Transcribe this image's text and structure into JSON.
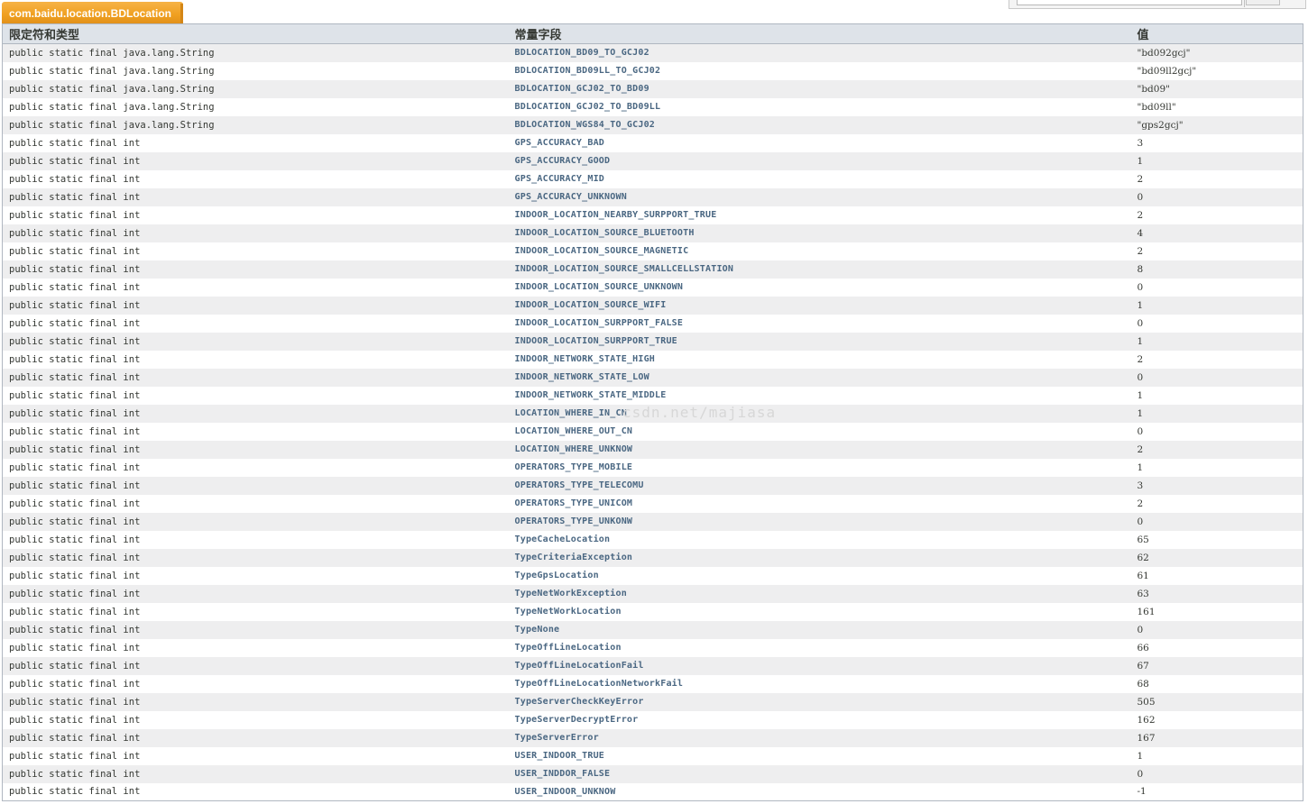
{
  "caption": "com.baidu.location.BDLocation",
  "watermark": "csdn.net/majiasa",
  "headers": [
    "限定符和类型",
    "常量字段",
    "值"
  ],
  "rows": [
    {
      "modifier": "public static final java.lang.String",
      "name": "BDLOCATION_BD09_TO_GCJ02",
      "value": "\"bd092gcj\""
    },
    {
      "modifier": "public static final java.lang.String",
      "name": "BDLOCATION_BD09LL_TO_GCJ02",
      "value": "\"bd09ll2gcj\""
    },
    {
      "modifier": "public static final java.lang.String",
      "name": "BDLOCATION_GCJ02_TO_BD09",
      "value": "\"bd09\""
    },
    {
      "modifier": "public static final java.lang.String",
      "name": "BDLOCATION_GCJ02_TO_BD09LL",
      "value": "\"bd09ll\""
    },
    {
      "modifier": "public static final java.lang.String",
      "name": "BDLOCATION_WGS84_TO_GCJ02",
      "value": "\"gps2gcj\""
    },
    {
      "modifier": "public static final int",
      "name": "GPS_ACCURACY_BAD",
      "value": "3"
    },
    {
      "modifier": "public static final int",
      "name": "GPS_ACCURACY_GOOD",
      "value": "1"
    },
    {
      "modifier": "public static final int",
      "name": "GPS_ACCURACY_MID",
      "value": "2"
    },
    {
      "modifier": "public static final int",
      "name": "GPS_ACCURACY_UNKNOWN",
      "value": "0"
    },
    {
      "modifier": "public static final int",
      "name": "INDOOR_LOCATION_NEARBY_SURPPORT_TRUE",
      "value": "2"
    },
    {
      "modifier": "public static final int",
      "name": "INDOOR_LOCATION_SOURCE_BLUETOOTH",
      "value": "4"
    },
    {
      "modifier": "public static final int",
      "name": "INDOOR_LOCATION_SOURCE_MAGNETIC",
      "value": "2"
    },
    {
      "modifier": "public static final int",
      "name": "INDOOR_LOCATION_SOURCE_SMALLCELLSTATION",
      "value": "8"
    },
    {
      "modifier": "public static final int",
      "name": "INDOOR_LOCATION_SOURCE_UNKNOWN",
      "value": "0"
    },
    {
      "modifier": "public static final int",
      "name": "INDOOR_LOCATION_SOURCE_WIFI",
      "value": "1"
    },
    {
      "modifier": "public static final int",
      "name": "INDOOR_LOCATION_SURPPORT_FALSE",
      "value": "0"
    },
    {
      "modifier": "public static final int",
      "name": "INDOOR_LOCATION_SURPPORT_TRUE",
      "value": "1"
    },
    {
      "modifier": "public static final int",
      "name": "INDOOR_NETWORK_STATE_HIGH",
      "value": "2"
    },
    {
      "modifier": "public static final int",
      "name": "INDOOR_NETWORK_STATE_LOW",
      "value": "0"
    },
    {
      "modifier": "public static final int",
      "name": "INDOOR_NETWORK_STATE_MIDDLE",
      "value": "1"
    },
    {
      "modifier": "public static final int",
      "name": "LOCATION_WHERE_IN_CN",
      "value": "1"
    },
    {
      "modifier": "public static final int",
      "name": "LOCATION_WHERE_OUT_CN",
      "value": "0"
    },
    {
      "modifier": "public static final int",
      "name": "LOCATION_WHERE_UNKNOW",
      "value": "2"
    },
    {
      "modifier": "public static final int",
      "name": "OPERATORS_TYPE_MOBILE",
      "value": "1"
    },
    {
      "modifier": "public static final int",
      "name": "OPERATORS_TYPE_TELECOMU",
      "value": "3"
    },
    {
      "modifier": "public static final int",
      "name": "OPERATORS_TYPE_UNICOM",
      "value": "2"
    },
    {
      "modifier": "public static final int",
      "name": "OPERATORS_TYPE_UNKONW",
      "value": "0"
    },
    {
      "modifier": "public static final int",
      "name": "TypeCacheLocation",
      "value": "65"
    },
    {
      "modifier": "public static final int",
      "name": "TypeCriteriaException",
      "value": "62"
    },
    {
      "modifier": "public static final int",
      "name": "TypeGpsLocation",
      "value": "61"
    },
    {
      "modifier": "public static final int",
      "name": "TypeNetWorkException",
      "value": "63"
    },
    {
      "modifier": "public static final int",
      "name": "TypeNetWorkLocation",
      "value": "161"
    },
    {
      "modifier": "public static final int",
      "name": "TypeNone",
      "value": "0"
    },
    {
      "modifier": "public static final int",
      "name": "TypeOffLineLocation",
      "value": "66"
    },
    {
      "modifier": "public static final int",
      "name": "TypeOffLineLocationFail",
      "value": "67"
    },
    {
      "modifier": "public static final int",
      "name": "TypeOffLineLocationNetworkFail",
      "value": "68"
    },
    {
      "modifier": "public static final int",
      "name": "TypeServerCheckKeyError",
      "value": "505"
    },
    {
      "modifier": "public static final int",
      "name": "TypeServerDecryptError",
      "value": "162"
    },
    {
      "modifier": "public static final int",
      "name": "TypeServerError",
      "value": "167"
    },
    {
      "modifier": "public static final int",
      "name": "USER_INDOOR_TRUE",
      "value": "1"
    },
    {
      "modifier": "public static final int",
      "name": "USER_INDDOR_FALSE",
      "value": "0"
    },
    {
      "modifier": "public static final int",
      "name": "USER_INDOOR_UNKNOW",
      "value": "-1"
    }
  ]
}
